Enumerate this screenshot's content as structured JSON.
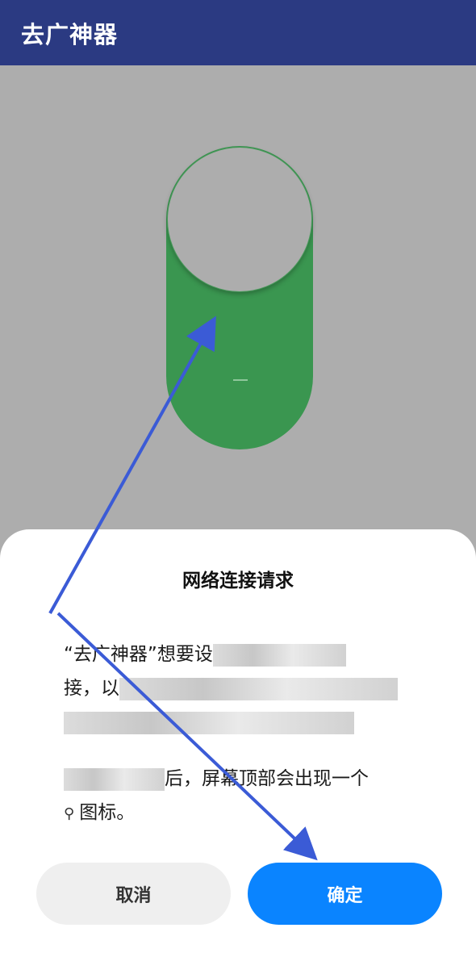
{
  "app": {
    "title": "去广神器"
  },
  "dialog": {
    "title": "网络连接请求",
    "paragraph1_visible": "“去广神器”想要设",
    "paragraph1_line2_start": "接，以",
    "paragraph2_end": "后，屏幕顶部会出现一个",
    "paragraph2_line2": "图标。",
    "cancel_label": "取消",
    "ok_label": "确定"
  },
  "icons": {
    "key": "key-icon"
  },
  "colors": {
    "app_bar": "#2b3a82",
    "toggle_on": "#3a9650",
    "ok_button": "#0a84ff",
    "annotation_arrow": "#3b5bd6"
  }
}
